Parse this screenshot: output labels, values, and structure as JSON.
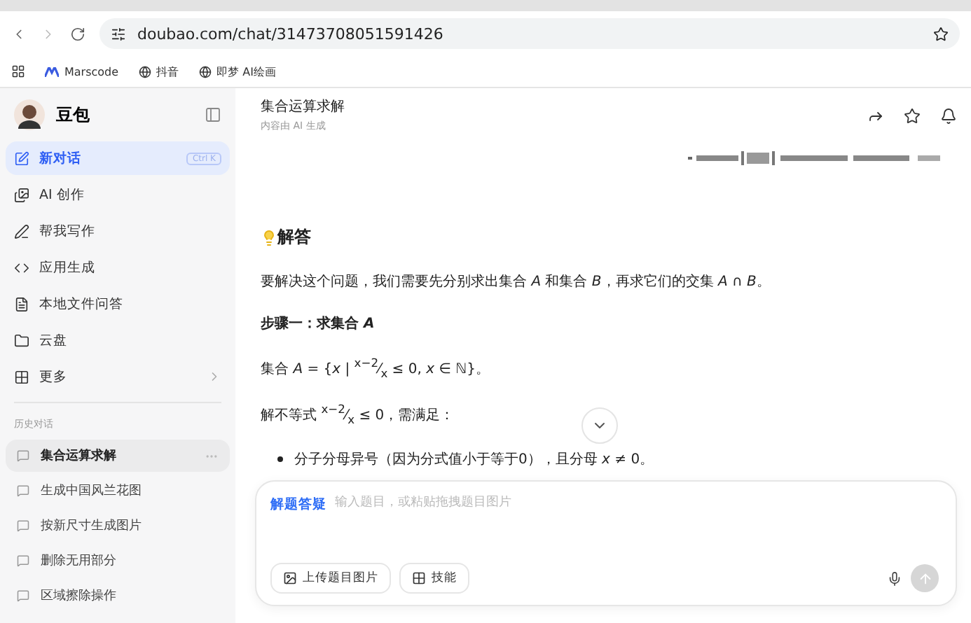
{
  "browser": {
    "url": "doubao.com/chat/31473708051591426",
    "bookmarks": [
      "Marscode",
      "抖音",
      "即梦 AI绘画"
    ]
  },
  "sidebar": {
    "app_name": "豆包",
    "nav": [
      {
        "label": "新对话",
        "selected": true,
        "shortcut": "Ctrl K",
        "submenu": false
      },
      {
        "label": "AI 创作",
        "selected": false,
        "submenu": false
      },
      {
        "label": "帮我写作",
        "selected": false,
        "submenu": false
      },
      {
        "label": "应用生成",
        "selected": false,
        "submenu": false
      },
      {
        "label": "本地文件问答",
        "selected": false,
        "submenu": false
      },
      {
        "label": "云盘",
        "selected": false,
        "submenu": false
      },
      {
        "label": "更多",
        "selected": false,
        "submenu": true
      }
    ],
    "history_heading": "历史对话",
    "history": [
      {
        "label": "集合运算求解",
        "selected": true
      },
      {
        "label": "生成中国风兰花图",
        "selected": false
      },
      {
        "label": "按新尺寸生成图片",
        "selected": false
      },
      {
        "label": "删除无用部分",
        "selected": false
      },
      {
        "label": "区域擦除操作",
        "selected": false
      }
    ]
  },
  "chat": {
    "title": "集合运算求解",
    "subtitle": "内容由 AI 生成",
    "answer_heading": "解答",
    "blocks": [
      {
        "kind": "text",
        "text": "要解决这个问题，我们需要先分别求出集合 *A* 和集合 *B*，再求它们的交集 *A* ∩ *B*。"
      },
      {
        "kind": "step",
        "text": "步骤一：求集合 *A*"
      },
      {
        "kind": "text",
        "text": "集合 *A* = {*x* | $^{x−2}$⁄$_{x}$ ≤ 0, *x* ∈ ℕ}。"
      },
      {
        "kind": "text",
        "text": "解不等式 $^{x−2}$⁄$_{x}$ ≤ 0，需满足："
      },
      {
        "kind": "bullet",
        "text": "分子分母异号（因为分式值小于等于0），且分母 *x* ≠ 0。"
      }
    ]
  },
  "composer": {
    "mode": "解题答疑",
    "placeholder": "输入题目，或粘贴拖拽题目图片",
    "buttons": [
      "上传题目图片",
      "技能"
    ]
  }
}
